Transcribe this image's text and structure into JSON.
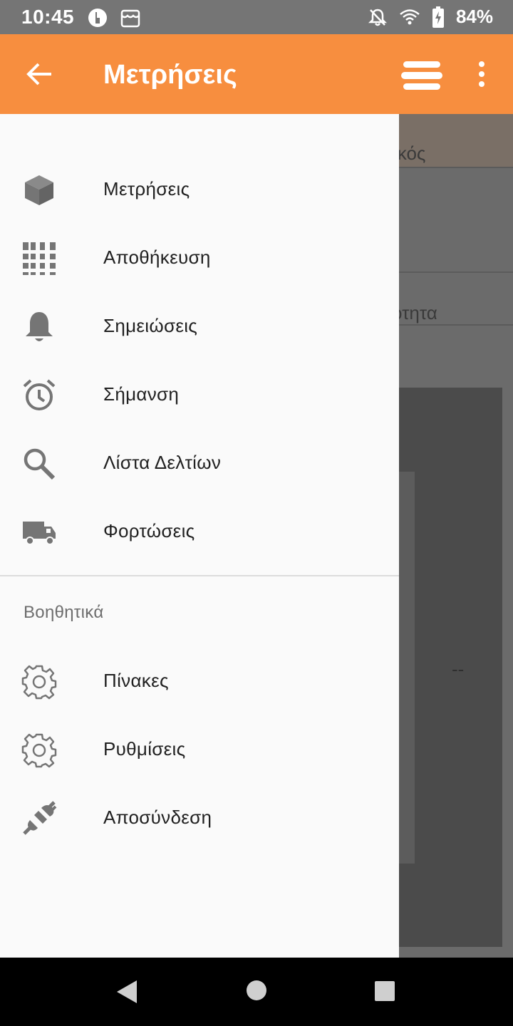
{
  "status_bar": {
    "time": "10:45",
    "battery": "84%",
    "icons": [
      "app-circle-icon",
      "store-icon",
      "bell-off-icon",
      "wifi-icon",
      "battery-charging-icon"
    ]
  },
  "app_bar": {
    "title": "Μετρήσεις",
    "back_icon": "arrow-left-icon",
    "menu_icon": "menu-lines-icon",
    "overflow_icon": "kebab-icon"
  },
  "background": {
    "row1_text": "ικός",
    "row2_text": "ότητα",
    "value": "--"
  },
  "drawer": {
    "items": [
      {
        "label": "Μετρήσεις",
        "icon": "cube-icon"
      },
      {
        "label": "Αποθήκευση",
        "icon": "shelves-icon"
      },
      {
        "label": "Σημειώσεις",
        "icon": "bell-icon"
      },
      {
        "label": "Σήμανση",
        "icon": "alarm-clock-icon"
      },
      {
        "label": "Λίστα Δελτίων",
        "icon": "search-icon"
      },
      {
        "label": "Φορτώσεις",
        "icon": "truck-icon"
      }
    ],
    "section_title": "Βοηθητικά",
    "aux_items": [
      {
        "label": "Πίνακες",
        "icon": "gear-icon"
      },
      {
        "label": "Ρυθμίσεις",
        "icon": "gear-icon"
      },
      {
        "label": "Αποσύνδεση",
        "icon": "unplug-icon"
      }
    ]
  },
  "colors": {
    "accent": "#f78e3f",
    "drawer_bg": "#fafafa",
    "icon": "#757575"
  }
}
